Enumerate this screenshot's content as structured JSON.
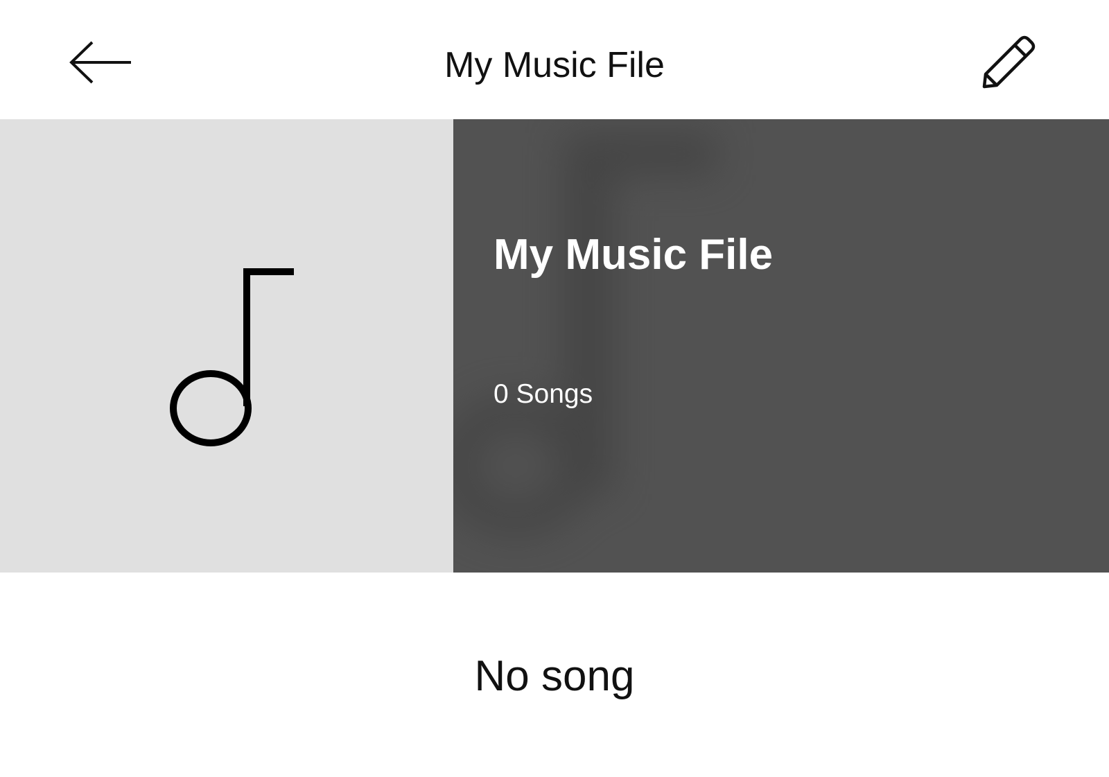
{
  "header": {
    "title": "My Music File",
    "back_icon": "arrow-left-icon",
    "edit_icon": "pencil-icon"
  },
  "playlist": {
    "name": "My Music File",
    "song_count": "0 Songs",
    "cover_icon": "music-note-icon"
  },
  "content": {
    "empty_message": "No song"
  },
  "colors": {
    "header_bg": "#ffffff",
    "cover_bg": "#e0e0e0",
    "info_bg": "#525252",
    "text_dark": "#111111",
    "text_light": "#ffffff"
  }
}
